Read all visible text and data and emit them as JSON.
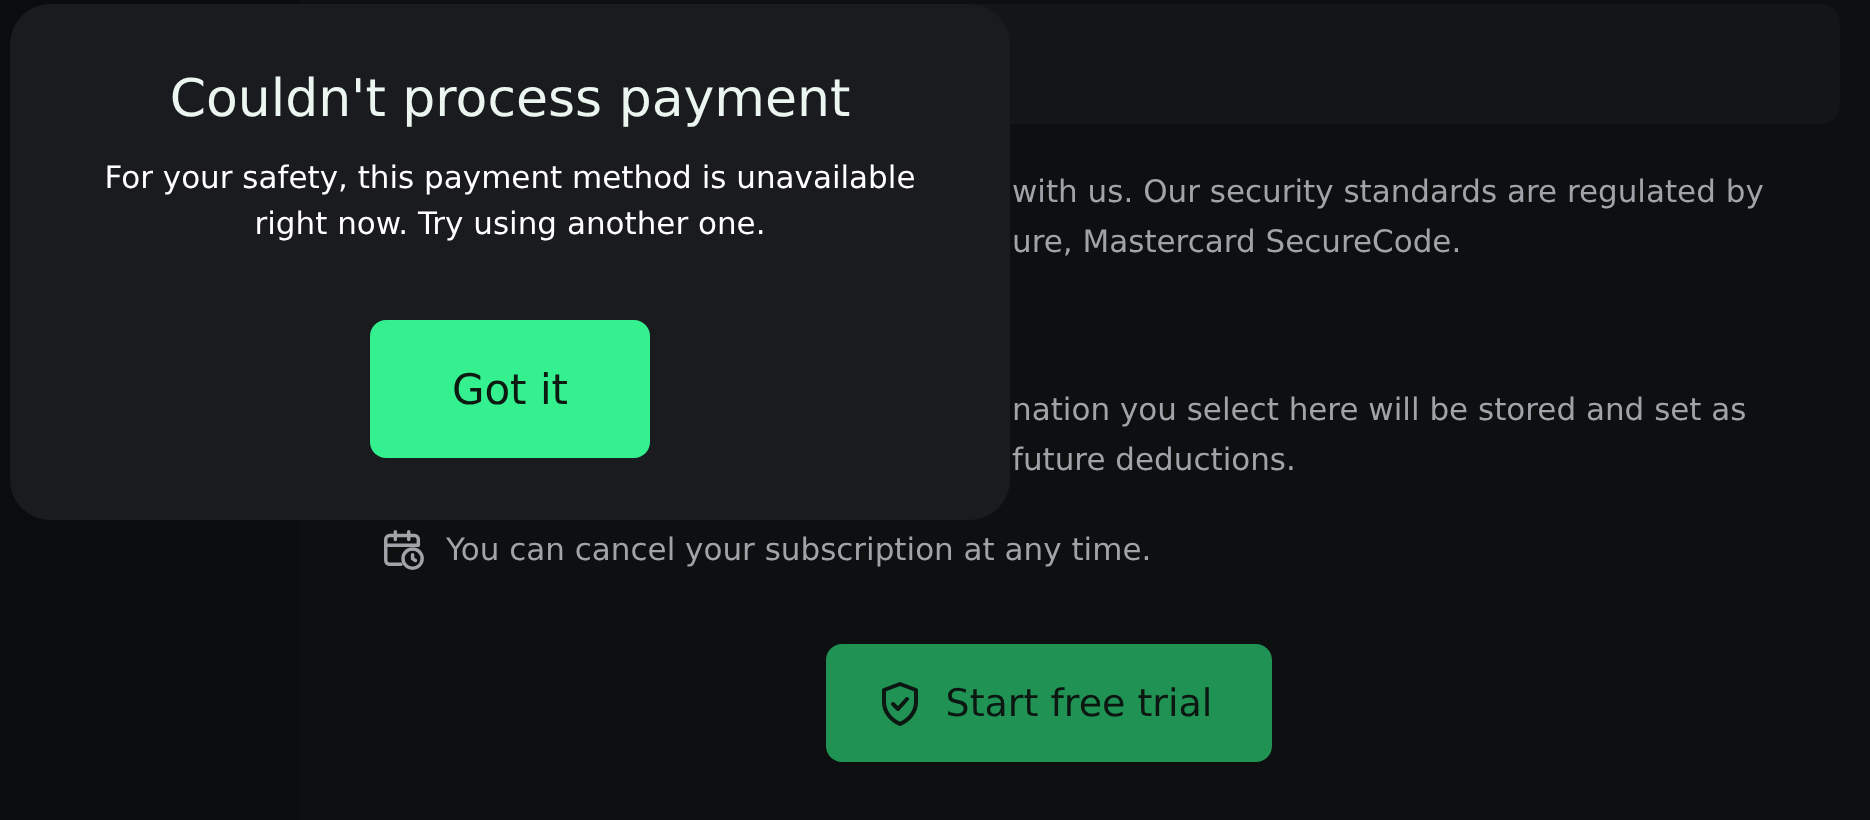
{
  "background_text": [
    {
      "kind": "line",
      "text": "with us. Our security standards are regulated by"
    },
    {
      "kind": "line",
      "text": "ure, Mastercard SecureCode."
    },
    {
      "kind": "gap"
    },
    {
      "kind": "line",
      "text": "nation you select here will be stored and set as"
    },
    {
      "kind": "line",
      "text": "future deductions."
    }
  ],
  "cancel_note": {
    "text": "You can cancel your subscription at any time."
  },
  "trial_button": {
    "label": "Start free trial"
  },
  "dialog": {
    "title": "Couldn't process payment",
    "message": "For your safety, this payment method is unavailable right now. Try using another one.",
    "button": "Got it"
  }
}
